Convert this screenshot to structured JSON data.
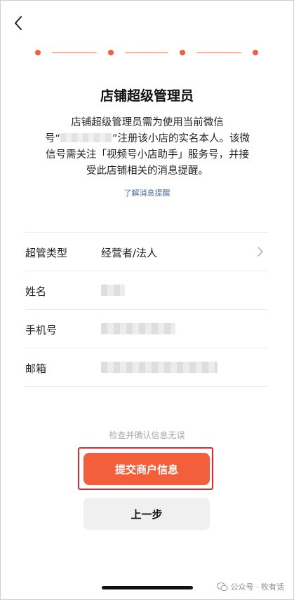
{
  "header": {
    "back_icon": "chevron-left-icon"
  },
  "steps": {
    "count": 4,
    "accent_color": "#f25f3a"
  },
  "title": "店铺超级管理员",
  "description": {
    "line1": "店铺超级管理员需为使用当前微信",
    "line2_prefix": "号“",
    "line2_suffix": "”注册该小店的实名本人。该微",
    "line3": "信号需关注「视频号小店助手」服务号，并接",
    "line4": "受此店铺相关的消息提醒。"
  },
  "learn_more": "了解消息提醒",
  "form": {
    "rows": [
      {
        "label": "超管类型",
        "value": "经营者/法人"
      },
      {
        "label": "姓名"
      },
      {
        "label": "手机号"
      },
      {
        "label": "邮箱"
      }
    ]
  },
  "confirm_hint": "检查并确认信息无误",
  "buttons": {
    "submit": "提交商户信息",
    "previous": "上一步"
  },
  "watermark": {
    "text": "公众号 · 牧有话"
  }
}
